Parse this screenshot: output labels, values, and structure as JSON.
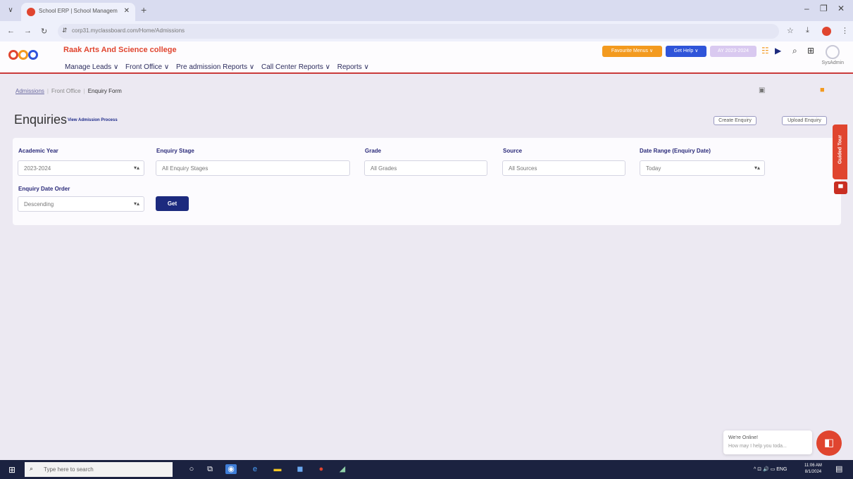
{
  "browser": {
    "tab_title": "School ERP | School Managem...",
    "tab_close": "✕",
    "new_tab": "+",
    "address": "corp31.myclassboard.com/Home/Admissions"
  },
  "header": {
    "college_name": "Raak Arts And Science college",
    "menu": [
      "Manage Leads ∨",
      "Front Office ∨",
      "Pre admission Reports ∨",
      "Call Center Reports ∨",
      "Reports ∨"
    ],
    "favourite_label": "Favourite Menus ∨",
    "help_label": "Get Help ∨",
    "year_label": "AY 2023-2024",
    "user_name": "SysAdmin"
  },
  "breadcrumb": {
    "items": [
      "Admissions",
      "Front Office",
      "Enquiry Form"
    ]
  },
  "page": {
    "title": "Enquiries",
    "subtitle": "View Admission Process",
    "create_label": "Create Enquiry",
    "upload_label": "Upload Enquiry"
  },
  "filters": {
    "academic_year_label": "Academic Year",
    "academic_year_value": "2023-2024",
    "enquiry_stage_label": "Enquiry Stage",
    "enquiry_stage_value": "All Enquiry Stages",
    "grade_label": "Grade",
    "grade_value": "All Grades",
    "source_label": "Source",
    "source_value": "All Sources",
    "date_range_label": "Date Range (Enquiry Date)",
    "date_range_value": "Today",
    "order_label": "Enquiry Date Order",
    "order_value": "Descending",
    "get_label": "Get"
  },
  "guided_tour": "Guided Tour",
  "chat": {
    "line1": "We're Online!",
    "line2": "How may I help you toda..."
  },
  "taskbar": {
    "search_placeholder": "Type here to search",
    "tray_text": "^  ⊡  🔊  ▭  ENG",
    "time": "11:06 AM",
    "date": "8/1/2024"
  },
  "colors": {
    "accent_red": "#e0452f",
    "primary_navy": "#1c2a7e",
    "favourite_orange": "#f39a1f",
    "help_blue": "#2f54d9",
    "year_lavender": "#d9c9f0"
  }
}
